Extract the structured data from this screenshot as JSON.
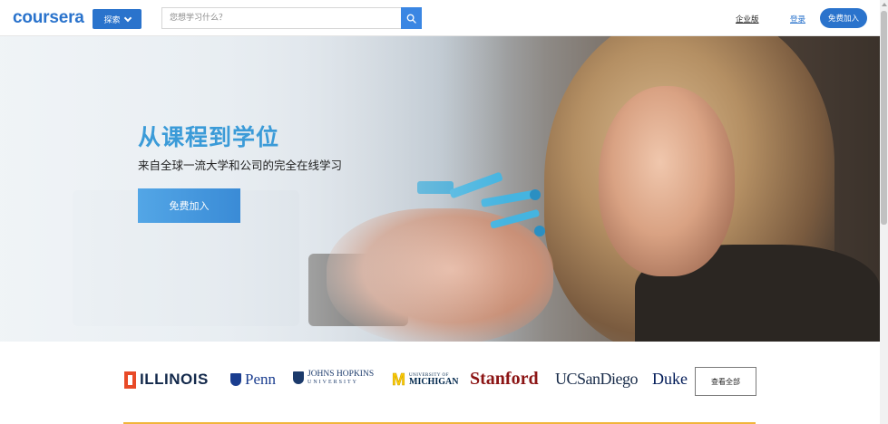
{
  "header": {
    "logo": "coursera",
    "explore_label": "探索",
    "search": {
      "placeholder": "您想学习什么？",
      "value": ""
    },
    "enterprise_link": "企业版",
    "login_link": "登录",
    "join_button": "免费加入"
  },
  "hero": {
    "title": "从课程到学位",
    "subtitle": "来自全球一流大学和公司的完全在线学习",
    "cta_button": "免费加入"
  },
  "partners": {
    "logos": [
      {
        "name": "ILLINOIS"
      },
      {
        "name": "Penn"
      },
      {
        "name": "JOHNS HOPKINS",
        "sub": "UNIVERSITY"
      },
      {
        "name": "MICHIGAN",
        "pre": "UNIVERSITY OF"
      },
      {
        "name": "Stanford"
      },
      {
        "name": "UCSanDiego"
      },
      {
        "name": "Duke"
      }
    ],
    "view_all_button": "查看全部"
  },
  "colors": {
    "brand": "#2a73cc",
    "hero_title": "#3b9bd8",
    "illinois": "#e84a27",
    "stanford": "#8c1515",
    "michigan_maize": "#ffcb05"
  },
  "icons": [
    "chevron-down-icon",
    "search-icon",
    "illinois-logo-icon",
    "penn-shield-icon",
    "jhu-shield-icon",
    "michigan-m-icon"
  ]
}
